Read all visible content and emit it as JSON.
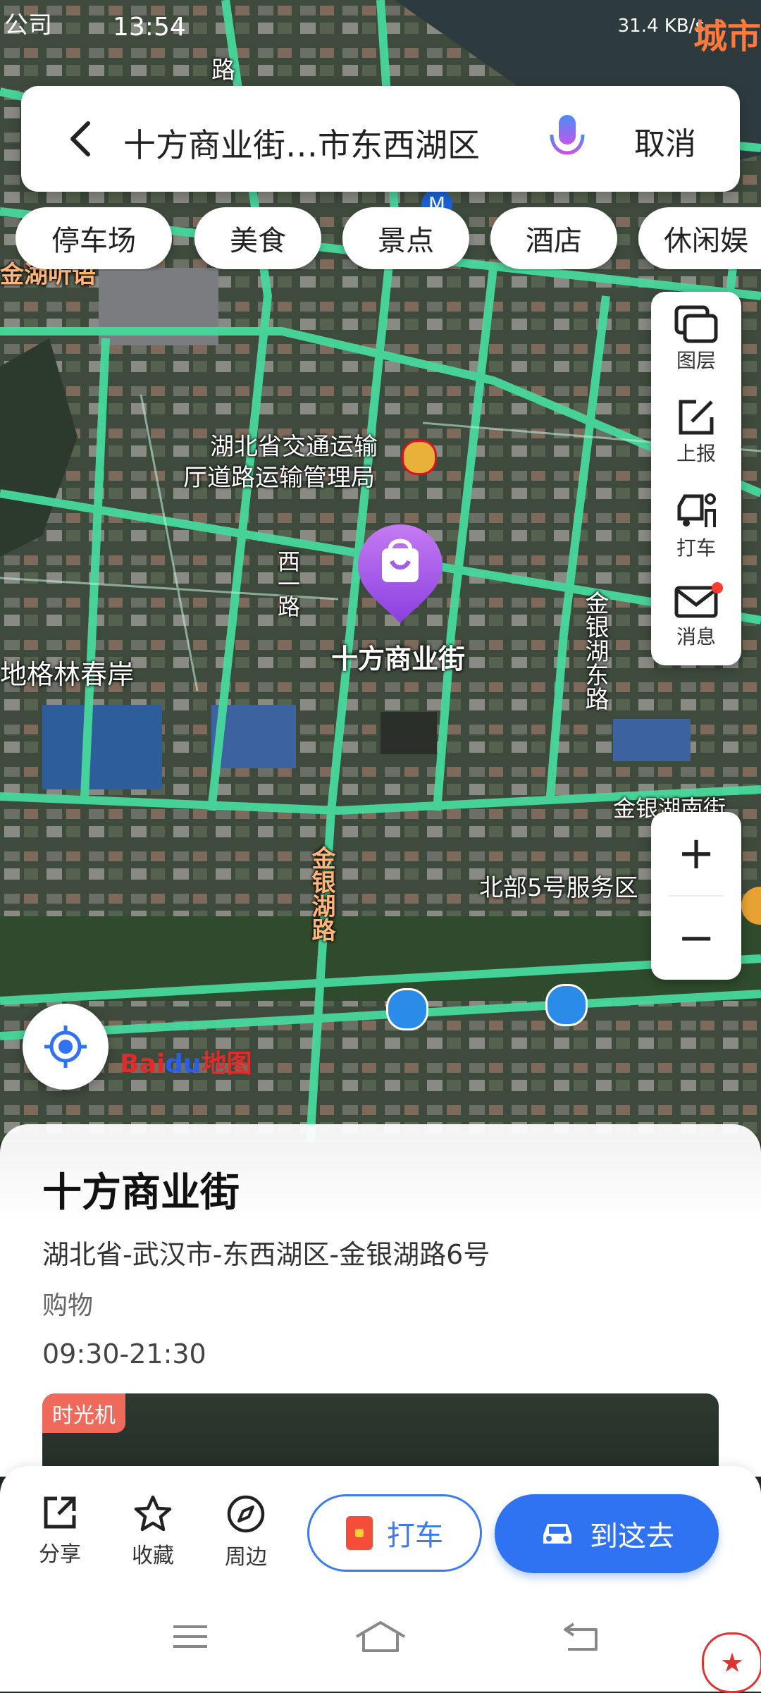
{
  "status_bar": {
    "carrier": "公司",
    "time": "13:54",
    "net_speed": "31.4 KB/s",
    "corner_text": "城市"
  },
  "search": {
    "query": "十方商业街…市东西湖区",
    "cancel_label": "取消"
  },
  "categories": [
    "停车场",
    "美食",
    "景点",
    "酒店",
    "休闲娱"
  ],
  "side_tools": [
    {
      "icon": "layers-icon",
      "label": "图层"
    },
    {
      "icon": "report-icon",
      "label": "上报"
    },
    {
      "icon": "taxi-icon",
      "label": "打车"
    },
    {
      "icon": "message-icon",
      "label": "消息"
    }
  ],
  "zoom": {
    "in": "+",
    "out": "−"
  },
  "map_labels": {
    "bureau_line1": "湖北省交通运输",
    "bureau_line2": "厅道路运输管理局",
    "xiyi_road": "西一路",
    "spring_shore": "地格林春岸",
    "jinyin_east_road": "金银湖东路",
    "jinyin_south_street": "金银湖南街",
    "jinyin_road": "金银湖路",
    "north5_service": "北部5号服务区",
    "top_left_road": "金湖听语",
    "top_road": "路",
    "metro": "M"
  },
  "poi": {
    "name": "十方商业街",
    "address": "湖北省-武汉市-东西湖区-金银湖路6号",
    "category": "购物",
    "hours": "09:30-21:30",
    "photo_badge": "时光机"
  },
  "map_brand": {
    "bai": "Bai",
    "du": "du",
    "suffix": "地图"
  },
  "actions": {
    "share": "分享",
    "favorite": "收藏",
    "nearby": "周边",
    "taxi": "打车",
    "go": "到这去"
  },
  "stamp_glyph": "★"
}
